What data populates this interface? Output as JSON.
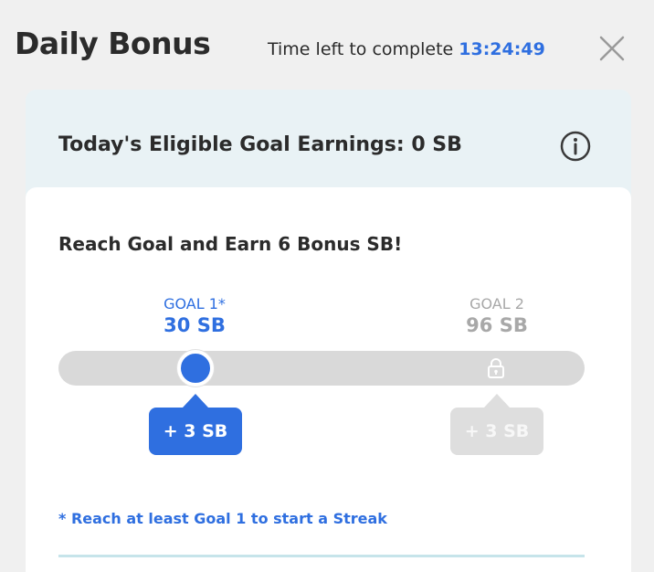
{
  "header": {
    "title": "Daily Bonus",
    "timer_label": "Time left to complete",
    "timer_value": "13:24:49"
  },
  "earnings": {
    "text": "Today's Eligible Goal Earnings: 0 SB"
  },
  "card": {
    "headline": "Reach Goal and Earn 6 Bonus SB!",
    "goals": [
      {
        "label": "GOAL 1*",
        "value": "30 SB",
        "reward": "+ 3 SB",
        "state": "active"
      },
      {
        "label": "GOAL 2",
        "value": "96 SB",
        "reward": "+ 3 SB",
        "state": "locked"
      }
    ],
    "progress_percent": 26,
    "streak_note": "* Reach at least Goal 1 to start a Streak"
  },
  "colors": {
    "accent": "#2f6fe0",
    "locked": "#a8a8a8",
    "panel_bg": "#e9f2f5",
    "track": "#d9d9d9"
  },
  "icons": {
    "close": "close-icon",
    "info": "info-icon",
    "lock": "lock-icon"
  }
}
